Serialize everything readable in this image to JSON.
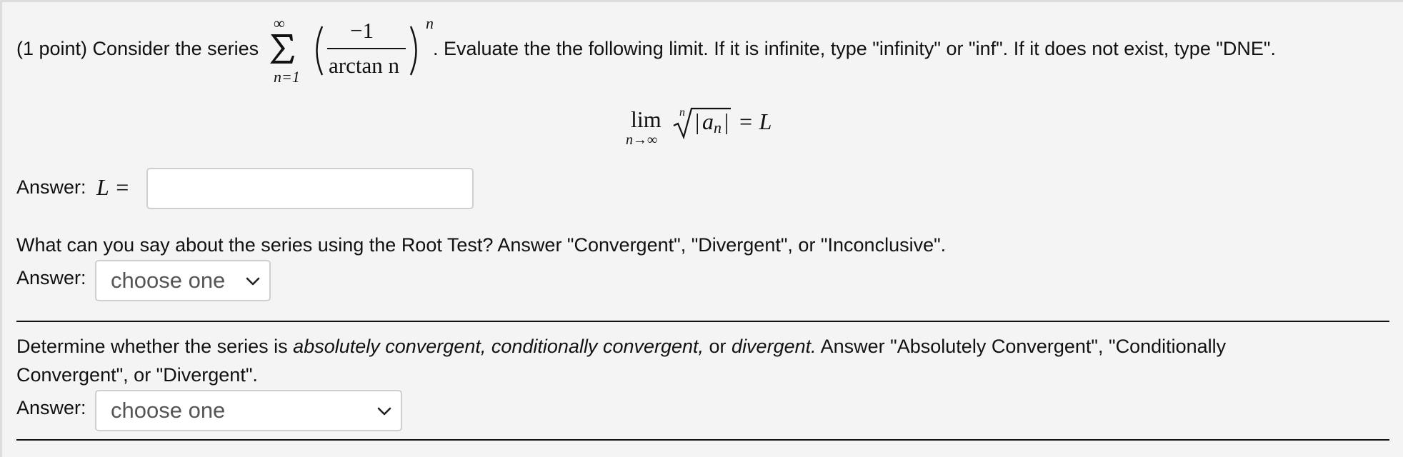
{
  "problem": {
    "intro": "(1 point) Consider the series",
    "series": {
      "sum_upper": "∞",
      "sum_lower": "n=1",
      "numerator": "−1",
      "denominator": "arctan n",
      "exponent": "n"
    },
    "instruction": ". Evaluate the the following limit. If it is infinite, type \"infinity\" or \"inf\". If it does not exist, type \"DNE\".",
    "limit": {
      "lim": "lim",
      "sub": "n→∞",
      "root_index": "n",
      "a": "a",
      "a_sub": "n",
      "equals": "= L"
    }
  },
  "q1": {
    "label": "Answer:",
    "math_label": "L =",
    "input_value": ""
  },
  "q2": {
    "text": "What can you say about the series using the Root Test? Answer \"Convergent\", \"Divergent\", or \"Inconclusive\".",
    "label": "Answer:",
    "select_value": "choose one"
  },
  "q3": {
    "text_a": "Determine whether the series is ",
    "text_em1": "absolutely convergent, conditionally convergent,",
    "text_b": " or ",
    "text_em2": "divergent.",
    "text_c": " Answer \"Absolutely Convergent\", \"Conditionally",
    "text_line2": "Convergent\", or \"Divergent\".",
    "label": "Answer:",
    "select_value": "choose one"
  }
}
